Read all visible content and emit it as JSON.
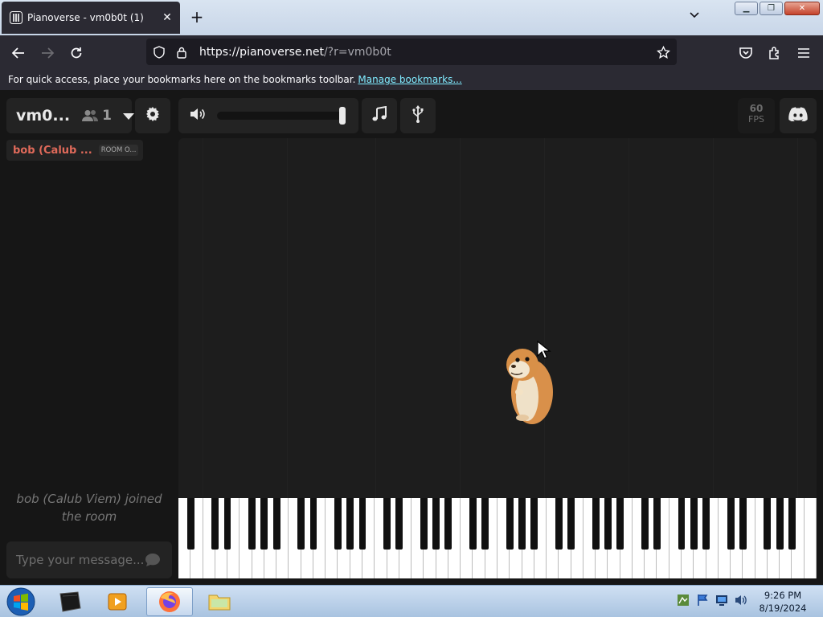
{
  "browser": {
    "tab_title": "Pianoverse - vm0b0t (1)",
    "url_domain": "https://pianoverse.net",
    "url_path": "/?r=vm0b0t",
    "bookmark_msg": "For quick access, place your bookmarks here on the bookmarks toolbar.",
    "bookmark_link": "Manage bookmarks..."
  },
  "room": {
    "name": "vm0...",
    "user_count": "1"
  },
  "users": [
    {
      "name": "bob (Calub ...",
      "tag": "ROOM O..."
    }
  ],
  "volume": {
    "level": 1.0
  },
  "fps": {
    "value": "60",
    "label": "FPS"
  },
  "chat": {
    "message": "bob (Calub Viem) joined the room",
    "placeholder": "Type your message..."
  },
  "taskbar": {
    "time": "9:26 PM",
    "date": "8/19/2024"
  },
  "colors": {
    "accent_user": "#e06a5a",
    "link": "#80ebff",
    "panel": "#232323"
  }
}
